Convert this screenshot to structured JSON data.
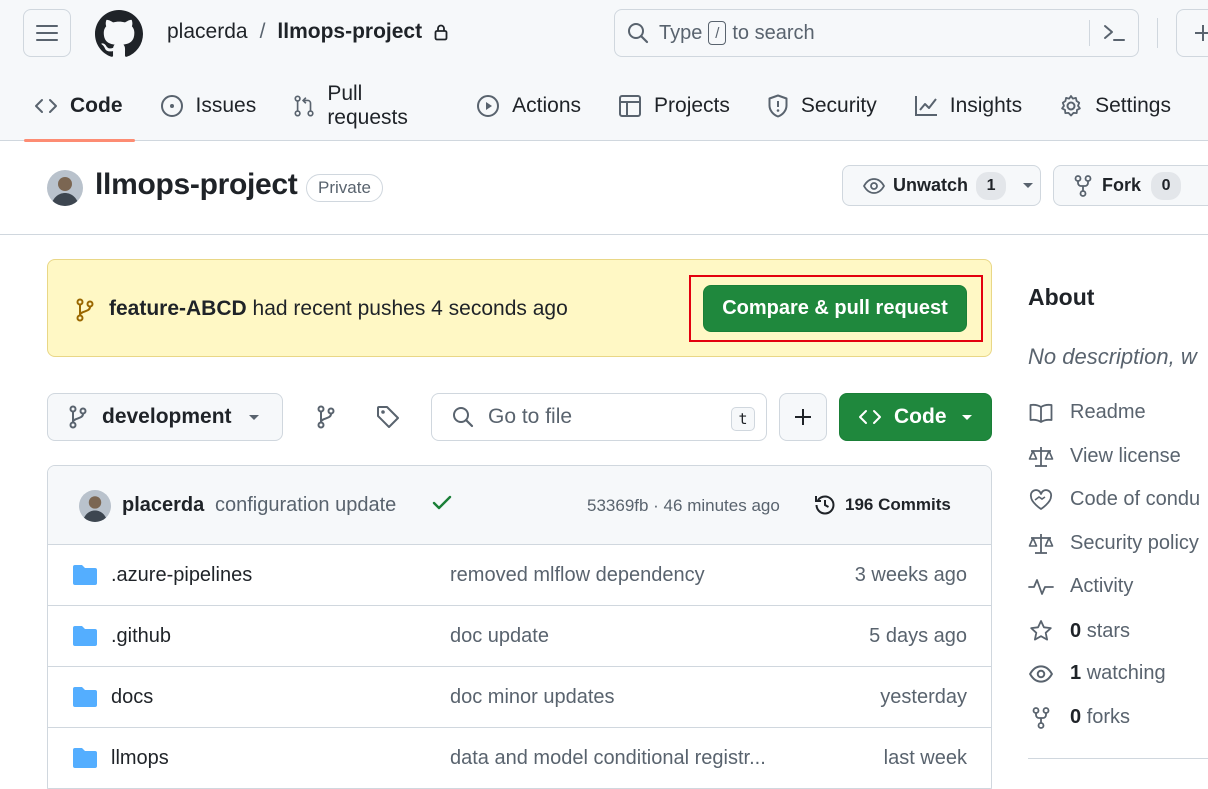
{
  "header": {
    "owner": "placerda",
    "separator": "/",
    "repo": "llmops-project",
    "search_prefix": "Type",
    "search_key": "/",
    "search_suffix": "to search"
  },
  "tabs": [
    {
      "label": "Code",
      "icon": "code-icon",
      "selected": true
    },
    {
      "label": "Issues",
      "icon": "issue-icon"
    },
    {
      "label": "Pull requests",
      "icon": "pull-request-icon"
    },
    {
      "label": "Actions",
      "icon": "play-icon"
    },
    {
      "label": "Projects",
      "icon": "table-icon"
    },
    {
      "label": "Security",
      "icon": "shield-icon"
    },
    {
      "label": "Insights",
      "icon": "graph-icon"
    },
    {
      "label": "Settings",
      "icon": "gear-icon"
    }
  ],
  "repo": {
    "name": "llmops-project",
    "visibility": "Private",
    "watch_label": "Unwatch",
    "watch_count": "1",
    "fork_label": "Fork",
    "fork_count": "0"
  },
  "banner": {
    "branch": "feature-ABCD",
    "message": "had recent pushes 4 seconds ago",
    "button": "Compare & pull request"
  },
  "filenav": {
    "branch": "development",
    "goto_placeholder": "Go to file",
    "goto_key": "t",
    "code_label": "Code"
  },
  "commit": {
    "author": "placerda",
    "message": "configuration update",
    "hash_time": "53369fb · 46 minutes ago",
    "commits_label": "196 Commits"
  },
  "files": [
    {
      "name": ".azure-pipelines",
      "message": "removed mlflow dependency",
      "date": "3 weeks ago"
    },
    {
      "name": ".github",
      "message": "doc update",
      "date": "5 days ago"
    },
    {
      "name": "docs",
      "message": "doc minor updates",
      "date": "yesterday"
    },
    {
      "name": "llmops",
      "message": "data and model conditional registr...",
      "date": "last week"
    }
  ],
  "about": {
    "heading": "About",
    "description": "No description, w",
    "links": [
      {
        "icon": "book-icon",
        "label": "Readme"
      },
      {
        "icon": "law-icon",
        "label": "View license"
      },
      {
        "icon": "heart-handshake-icon",
        "label": "Code of condu"
      },
      {
        "icon": "law-icon",
        "label": "Security policy"
      },
      {
        "icon": "pulse-icon",
        "label": "Activity"
      }
    ],
    "stats": [
      {
        "icon": "star-icon",
        "count": "0",
        "label": "stars"
      },
      {
        "icon": "eye-icon",
        "count": "1",
        "label": "watching"
      },
      {
        "icon": "fork-icon",
        "count": "0",
        "label": "forks"
      }
    ]
  },
  "colors": {
    "primary_green": "#1f883d",
    "banner_bg": "#fff8c5",
    "highlight_red": "#e3000f",
    "tab_underline": "#fd8c73",
    "folder_blue": "#54aeff"
  }
}
